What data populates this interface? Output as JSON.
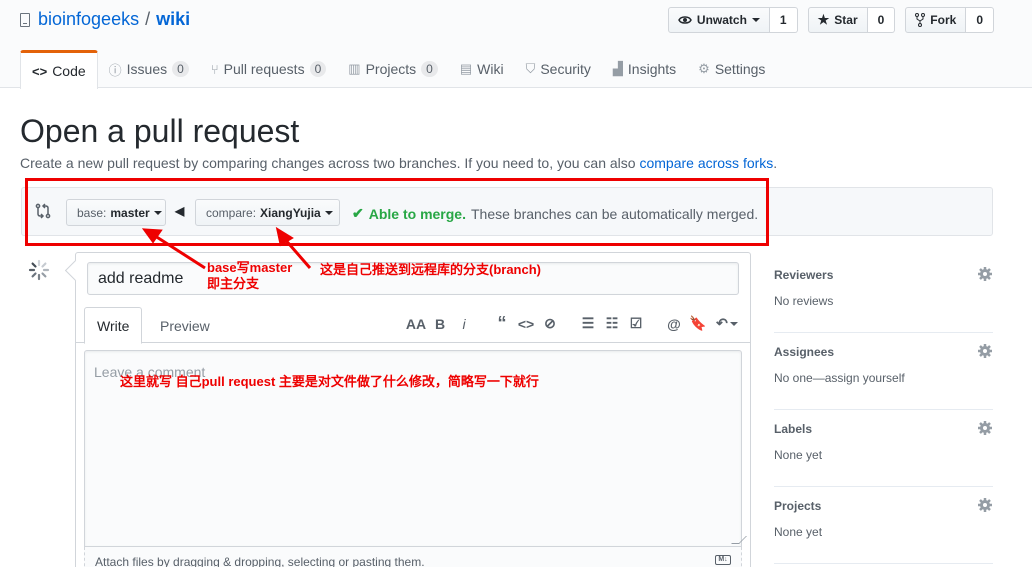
{
  "repo": {
    "owner": "bioinfogeeks",
    "separator": "/",
    "name": "wiki"
  },
  "actions": {
    "watch": {
      "label": "Unwatch",
      "count": "1"
    },
    "star": {
      "label": "Star",
      "count": "0"
    },
    "fork": {
      "label": "Fork",
      "count": "0"
    }
  },
  "tabs": [
    {
      "label": "Code",
      "icon": "<>"
    },
    {
      "label": "Issues",
      "count": "0"
    },
    {
      "label": "Pull requests",
      "count": "0"
    },
    {
      "label": "Projects",
      "count": "0"
    },
    {
      "label": "Wiki"
    },
    {
      "label": "Security"
    },
    {
      "label": "Insights"
    },
    {
      "label": "Settings"
    }
  ],
  "page": {
    "title": "Open a pull request",
    "subtitle": "Create a new pull request by comparing changes across two branches. If you need to, you can also ",
    "subtitle_link": "compare across forks",
    "subtitle_end": "."
  },
  "range": {
    "base_prefix": "base:",
    "base_branch": "master",
    "compare_prefix": "compare:",
    "compare_branch": "XiangYujia",
    "merge_ok": "Able to merge.",
    "merge_text": "These branches can be automatically merged."
  },
  "composer": {
    "title_value": "add readme",
    "tab_write": "Write",
    "tab_preview": "Preview",
    "placeholder": "Leave a comment",
    "attach_text": "Attach files by dragging & dropping, selecting or pasting them.",
    "md_label": "M↓"
  },
  "sidebar": [
    {
      "label": "Reviewers",
      "value": "No reviews"
    },
    {
      "label": "Assignees",
      "value": "No one—assign yourself"
    },
    {
      "label": "Labels",
      "value": "None yet"
    },
    {
      "label": "Projects",
      "value": "None yet"
    }
  ],
  "annotations": {
    "base_note_line1": "base写master",
    "base_note_line2": "即主分支",
    "compare_note": "这是自己推送到远程库的分支(branch)",
    "comment_note": "这里就写 自己pull request 主要是对文件做了什么修改，简略写一下就行"
  },
  "colors": {
    "accent": "#0366d6",
    "success": "#28a745",
    "annotation": "#e00000",
    "tab_border": "#e36209"
  }
}
